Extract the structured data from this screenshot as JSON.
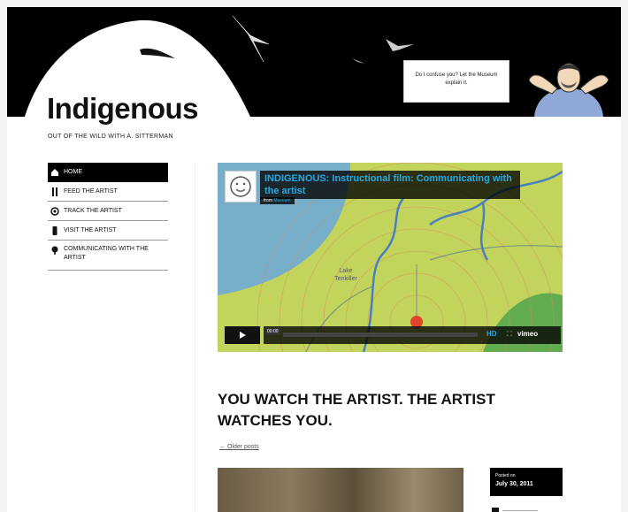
{
  "site": {
    "title": "Indigenous",
    "tagline": "OUT OF THE WILD WITH A. SITTERMAN"
  },
  "header": {
    "bubble_text": "Do I confuse you? Let the Museum explain it."
  },
  "nav": {
    "items": [
      {
        "label": "HOME",
        "icon": "home-icon",
        "active": true
      },
      {
        "label": "FEED THE ARTIST",
        "icon": "fork-knife-icon",
        "active": false
      },
      {
        "label": "TRACK THE ARTIST",
        "icon": "target-icon",
        "active": false
      },
      {
        "label": "VISIT THE ARTIST",
        "icon": "phone-icon",
        "active": false
      },
      {
        "label": "COMMUNICATING WITH THE ARTIST",
        "icon": "pin-icon",
        "active": false
      }
    ]
  },
  "video": {
    "title": "INDIGENOUS: Instructional film: Communicating with the artist",
    "by_prefix": "from",
    "by_name": "Museum",
    "place_label": "Lake Tenkiller",
    "time": "00:00",
    "hd_label": "HD",
    "brand": "vimeo",
    "colors": {
      "title": "#29a8e0",
      "map_green": "#c2d45c",
      "map_blue": "#6aa7dc",
      "dot": "#e0462c"
    }
  },
  "post": {
    "title": "YOU WATCH THE ARTIST. THE ARTIST WATCHES YOU.",
    "older_link": "← Older posts",
    "meta_label": "Posted on",
    "meta_date": "July 30, 2011"
  }
}
